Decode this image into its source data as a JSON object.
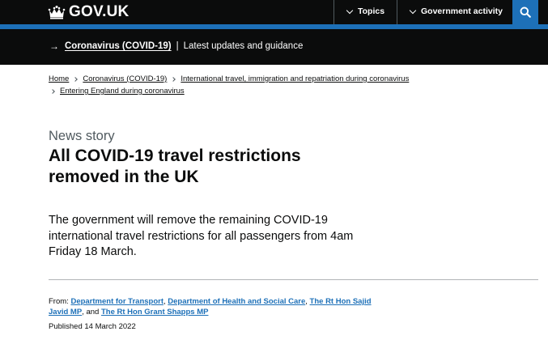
{
  "header": {
    "logo_text": "GOV.UK",
    "nav": {
      "topics_label": "Topics",
      "government_activity_label": "Government activity"
    },
    "search_icon": "search-icon"
  },
  "banner": {
    "arrow": "→",
    "link_text": "Coronavirus (COVID-19)",
    "separator": "|",
    "text": "Latest updates and guidance"
  },
  "breadcrumb": {
    "items": [
      "Home",
      "Coronavirus (COVID-19)",
      "International travel, immigration and repatriation during coronavirus",
      "Entering England during coronavirus"
    ]
  },
  "article": {
    "caption": "News story",
    "title": "All COVID-19 travel restrictions removed in the UK",
    "lead": "The government will remove the remaining COVID-19 international travel restrictions for all passengers from 4am Friday 18 March."
  },
  "metadata": {
    "from_label": "From:",
    "organisations": [
      "Department for Transport",
      "Department of Health and Social Care",
      "The Rt Hon Sajid Javid MP",
      "The Rt Hon Grant Shapps MP"
    ],
    "comma": ",",
    "and_text": ", and",
    "published": "Published 14 March 2022"
  },
  "colors": {
    "header_bg": "#0b0c0c",
    "brand_blue": "#1d70b8",
    "text": "#0b0c0c",
    "secondary_text": "#505a5f",
    "border": "#b1b4b6"
  }
}
